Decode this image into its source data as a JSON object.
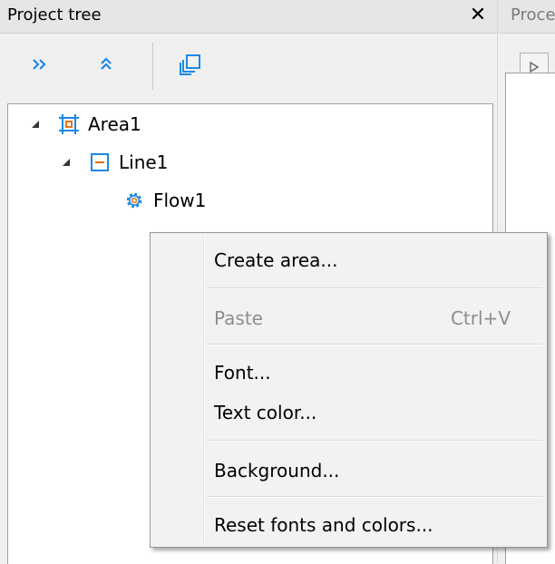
{
  "project_tree": {
    "title": "Project tree",
    "close_glyph": "✕",
    "toolbar": {
      "expand_all_icon": "double-chevron-right-icon",
      "collapse_all_icon": "double-chevron-up-icon",
      "copy_icon": "copy-window-icon"
    },
    "nodes": [
      {
        "label": "Area1",
        "icon": "area-icon",
        "expanded": true
      },
      {
        "label": "Line1",
        "icon": "line-icon",
        "expanded": true
      },
      {
        "label": "Flow1",
        "icon": "gear-icon"
      }
    ]
  },
  "process_panel": {
    "title": "Process"
  },
  "context_menu": {
    "items": [
      {
        "label": "Create area...",
        "shortcut": "",
        "enabled": true
      },
      {
        "label": "Paste",
        "shortcut": "Ctrl+V",
        "enabled": false
      },
      {
        "label": "Font...",
        "shortcut": "",
        "enabled": true
      },
      {
        "label": "Text color...",
        "shortcut": "",
        "enabled": true
      },
      {
        "label": "Background...",
        "shortcut": "",
        "enabled": true
      },
      {
        "label": "Reset fonts and colors...",
        "shortcut": "",
        "enabled": true
      }
    ]
  },
  "colors": {
    "accent_blue": "#1e88e5",
    "area_orange": "#e8731a"
  }
}
